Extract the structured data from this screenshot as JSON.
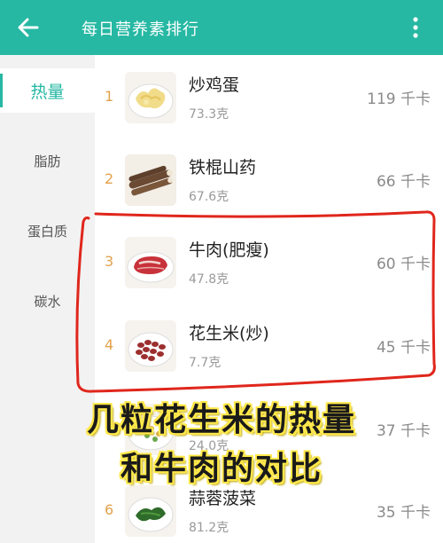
{
  "appbar": {
    "title": "每日营养素排行",
    "color": "#26b8a3"
  },
  "sidebar": {
    "tabs": [
      {
        "label": "热量",
        "active": true
      },
      {
        "label": "脂肪",
        "active": false
      },
      {
        "label": "蛋白质",
        "active": false
      },
      {
        "label": "碳水",
        "active": false
      }
    ]
  },
  "list": {
    "items": [
      {
        "rank": "1",
        "name": "炒鸡蛋",
        "amount": "73.3克",
        "kcal": "119 千卡",
        "icon": "scrambled-egg-thumb"
      },
      {
        "rank": "2",
        "name": "铁棍山药",
        "amount": "67.6克",
        "kcal": "66 千卡",
        "icon": "yam-thumb"
      },
      {
        "rank": "3",
        "name": "牛肉(肥瘦)",
        "amount": "47.8克",
        "kcal": "60 千卡",
        "icon": "beef-thumb"
      },
      {
        "rank": "4",
        "name": "花生米(炒)",
        "amount": "7.7克",
        "kcal": "45 千卡",
        "icon": "peanut-thumb"
      },
      {
        "rank": "",
        "name": "",
        "amount": "24.0克",
        "kcal": "37 千卡",
        "icon": "mixed-grain-thumb"
      },
      {
        "rank": "6",
        "name": "蒜蓉菠菜",
        "amount": "81.2克",
        "kcal": "35 千卡",
        "icon": "spinach-thumb"
      }
    ]
  },
  "overlay": {
    "caption_line1": "几粒花生米的热量",
    "caption_line2": "和牛肉的对比",
    "annotation_color": "#e0261c",
    "caption_fill": "#1a1a1a",
    "caption_outline": "#ffe84a"
  }
}
